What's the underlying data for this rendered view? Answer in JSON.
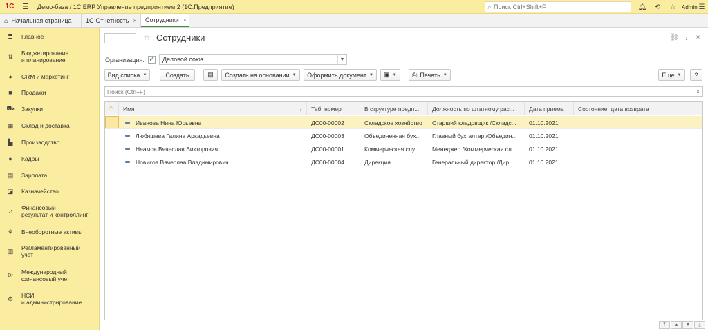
{
  "titlebar": {
    "logo": "1С",
    "title": "Демо-база / 1С:ERP Управление предприятием 2  (1С:Предприятие)",
    "search_placeholder": "Поиск Ctrl+Shift+F",
    "user": "Admin"
  },
  "tabs": [
    {
      "label": "Начальная страница"
    },
    {
      "label": "1С-Отчетность"
    },
    {
      "label": "Сотрудники"
    }
  ],
  "sidebar": {
    "items": [
      {
        "label": "Главное",
        "icon": "menu-icon"
      },
      {
        "label": "Бюджетирование\nи планирование",
        "icon": "budget-icon"
      },
      {
        "label": "CRM и маркетинг",
        "icon": "crm-icon"
      },
      {
        "label": "Продажи",
        "icon": "sales-icon"
      },
      {
        "label": "Закупки",
        "icon": "cart-icon"
      },
      {
        "label": "Склад и доставка",
        "icon": "warehouse-icon"
      },
      {
        "label": "Производство",
        "icon": "factory-icon"
      },
      {
        "label": "Кадры",
        "icon": "person-icon"
      },
      {
        "label": "Зарплата",
        "icon": "payroll-icon"
      },
      {
        "label": "Казначейство",
        "icon": "treasury-icon"
      },
      {
        "label": "Финансовый\nрезультат и контроллинг",
        "icon": "finance-icon"
      },
      {
        "label": "Внеоборотные активы",
        "icon": "assets-icon"
      },
      {
        "label": "Регламентированный\nучет",
        "icon": "accounting-icon"
      },
      {
        "label": "Международный\nфинансовый учет",
        "icon": "dr-cr-icon"
      },
      {
        "label": "НСИ\nи администрирование",
        "icon": "gear-icon"
      }
    ]
  },
  "page": {
    "title": "Сотрудники",
    "org_label": "Организация:",
    "org_value": "Деловой союз"
  },
  "toolbar": {
    "view_list": "Вид списка",
    "create": "Создать",
    "create_based": "Создать на основании",
    "make_document": "Оформить документ",
    "print": "Печать",
    "more": "Еще",
    "help": "?"
  },
  "list_search": {
    "placeholder": "Поиск (Ctrl+F)",
    "clear": "×"
  },
  "table": {
    "columns": [
      "Имя",
      "Таб. номер",
      "В структуре предп...",
      "Должность по штатному рас...",
      "Дата приема",
      "Состояние, дата возврата"
    ],
    "rows": [
      {
        "name": "Иванова Нина Юрьевна",
        "tab": "ДС00-00002",
        "struct": "Складское хозяйство",
        "position": "Старший кладовщик /Складс...",
        "date": "01.10.2021",
        "state": ""
      },
      {
        "name": "Любяшева Галина Аркадьевна",
        "tab": "ДС00-00003",
        "struct": "Объединенная бух...",
        "position": "Главный бухгалтер /Объедин...",
        "date": "01.10.2021",
        "state": ""
      },
      {
        "name": "Неамов Вячеслав Викторович",
        "tab": "ДС00-00001",
        "struct": "Коммерческая слу...",
        "position": "Менеджер /Коммерческая сл...",
        "date": "01.10.2021",
        "state": ""
      },
      {
        "name": "Новиков Вячеслав Владимирович",
        "tab": "ДС00-00004",
        "struct": "Дирекция",
        "position": "Генеральный директор /Дир...",
        "date": "01.10.2021",
        "state": ""
      }
    ]
  },
  "colors": {
    "accent_yellow": "#fbeda0",
    "selected_row": "#fcf1c0",
    "check_green": "#3b8f3b"
  }
}
